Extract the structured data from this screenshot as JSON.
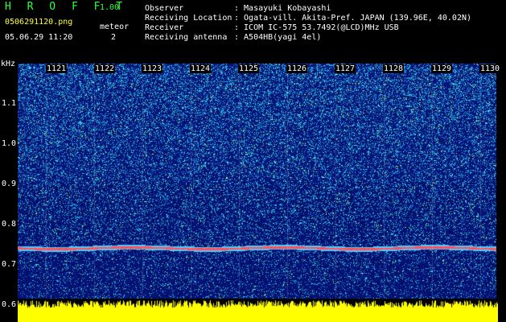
{
  "header": {
    "logo": "H R O F F T",
    "version": "1.00",
    "filename": "0506291120.png",
    "timestamp": "05.06.29 11:20",
    "meteor_label": "meteor",
    "meteor_count": "2"
  },
  "info": {
    "labels": [
      "Observer",
      "Receiving Location",
      "Receiver",
      "Receiving antenna"
    ],
    "values": [
      ": Masayuki Kobayashi",
      ": Ogata-vill. Akita-Pref. JAPAN (139.96E, 40.02N)",
      ": ICOM IC-575 53.7492(@LCD)MHz USB",
      ": A504HB(yagi 4el)"
    ]
  },
  "spectrogram": {
    "y_unit": "kHz",
    "y_ticks": [
      "1.1",
      "1.0",
      "0.9",
      "0.8",
      "0.7",
      "0.6"
    ],
    "x_ticks": [
      "1121",
      "1122",
      "1123",
      "1124",
      "1125",
      "1126",
      "1127",
      "1128",
      "1129",
      "1130"
    ],
    "colors": {
      "background": "#0a1a8c",
      "noise_hi": "#2fd0ff",
      "signal": "#ff3060",
      "amplitude": "#ffff00"
    }
  }
}
